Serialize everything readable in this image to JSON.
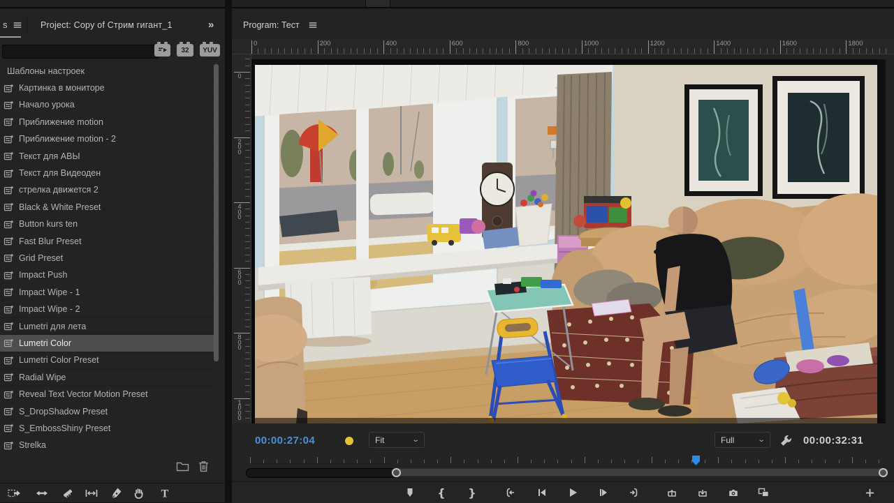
{
  "project_panel": {
    "partial_tab_label": "s",
    "tab_title": "Project: Copy of Стрим гигант_1",
    "overflow_indicator": "»",
    "search_value": "",
    "search_placeholder": "",
    "view_badges": [
      {
        "name": "preview-badge-icon",
        "label": ""
      },
      {
        "name": "32bpc-badge",
        "label": "32"
      },
      {
        "name": "yuv-badge",
        "label": "YUV"
      }
    ],
    "items": [
      {
        "label": "Шаблоны настроек",
        "has_icon": false,
        "selected": false
      },
      {
        "label": "Картинка в мониторе",
        "has_icon": true,
        "selected": false
      },
      {
        "label": "Начало урока",
        "has_icon": true,
        "selected": false
      },
      {
        "label": "Приближение motion",
        "has_icon": true,
        "selected": false
      },
      {
        "label": "Приближение motion - 2",
        "has_icon": true,
        "selected": false
      },
      {
        "label": "Текст для АВЫ",
        "has_icon": true,
        "selected": false
      },
      {
        "label": "Текст для Видеоден",
        "has_icon": true,
        "selected": false
      },
      {
        "label": "стрелка движется 2",
        "has_icon": true,
        "selected": false
      },
      {
        "label": "Black & White Preset",
        "has_icon": true,
        "selected": false
      },
      {
        "label": "Button kurs ten",
        "has_icon": true,
        "selected": false
      },
      {
        "label": "Fast Blur Preset",
        "has_icon": true,
        "selected": false
      },
      {
        "label": "Grid Preset",
        "has_icon": true,
        "selected": false
      },
      {
        "label": "Impact Push",
        "has_icon": true,
        "selected": false
      },
      {
        "label": "Impact Wipe - 1",
        "has_icon": true,
        "selected": false
      },
      {
        "label": "Impact Wipe - 2",
        "has_icon": true,
        "selected": false
      },
      {
        "label": "Lumetri для лета",
        "has_icon": true,
        "selected": false
      },
      {
        "label": "Lumetri Color",
        "has_icon": true,
        "selected": true
      },
      {
        "label": "Lumetri Color Preset",
        "has_icon": true,
        "selected": false
      },
      {
        "label": "Radial Wipe",
        "has_icon": true,
        "selected": false
      },
      {
        "label": "Reveal Text Vector Motion Preset",
        "has_icon": true,
        "selected": false
      },
      {
        "label": "S_DropShadow Preset",
        "has_icon": true,
        "selected": false
      },
      {
        "label": "S_EmbossShiny Preset",
        "has_icon": true,
        "selected": false
      },
      {
        "label": "Strelka",
        "has_icon": true,
        "selected": false
      }
    ],
    "footer_icons": [
      "new-bin-icon",
      "trash-icon"
    ]
  },
  "program_panel": {
    "tab_title": "Program: Тест",
    "h_ruler_labels": [
      "0",
      "200",
      "400",
      "600",
      "800",
      "1000",
      "1200",
      "1400",
      "1600",
      "1800"
    ],
    "v_ruler_labels": [
      "0",
      "200",
      "400",
      "600",
      "800",
      "1000"
    ],
    "current_timecode": "00:00:27:04",
    "fit_dropdown": "Fit",
    "quality_dropdown": "Full",
    "total_timecode": "00:00:32:31",
    "playhead_fraction": 0.7,
    "scroll_thumb_start_fraction": 0.226,
    "transport_buttons": [
      "add-marker",
      "mark-in",
      "mark-out",
      "go-to-in",
      "step-back",
      "play",
      "step-forward",
      "go-to-out",
      "lift",
      "extract",
      "export-frame",
      "comparison-view",
      "button-editor"
    ]
  },
  "tools": [
    "track-select-forward",
    "ripple-edit",
    "razor-tool",
    "slip-tool",
    "pen-tool",
    "hand-tool",
    "type-tool"
  ],
  "colors": {
    "panel_bg": "#232323",
    "timecode_blue": "#4a90d8",
    "playhead_blue": "#2d8ceb",
    "marker_yellow": "#e6c138",
    "selected_row": "#4e4e4e"
  }
}
